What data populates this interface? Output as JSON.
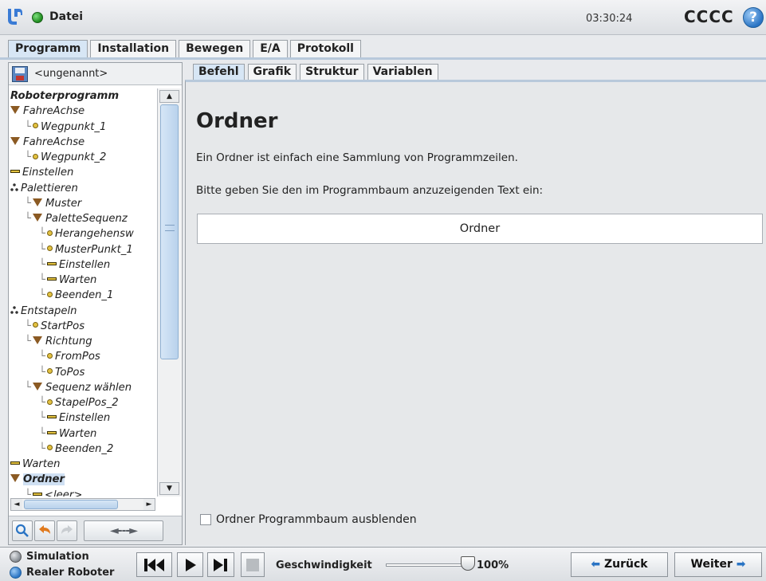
{
  "app": {
    "file_label": "Datei",
    "clock": "03:30:24",
    "robot_name": "CCCC",
    "help_glyph": "?"
  },
  "main_tabs": [
    "Programm",
    "Installation",
    "Bewegen",
    "E/A",
    "Protokoll"
  ],
  "program_name": "<ungenannt>",
  "tree": [
    {
      "indent": 0,
      "icon": "none",
      "label": "Roboterprogramm",
      "root": true
    },
    {
      "indent": 0,
      "icon": "folder-triangle",
      "label": "FahreAchse"
    },
    {
      "indent": 1,
      "icon": "waypoint-dot",
      "label": "Wegpunkt_1"
    },
    {
      "indent": 0,
      "icon": "folder-triangle",
      "label": "FahreAchse"
    },
    {
      "indent": 1,
      "icon": "waypoint-dot",
      "label": "Wegpunkt_2"
    },
    {
      "indent": 0,
      "icon": "bar",
      "label": "Einstellen"
    },
    {
      "indent": 0,
      "icon": "pallet",
      "label": "Palettieren"
    },
    {
      "indent": 1,
      "icon": "folder-triangle",
      "label": "Muster"
    },
    {
      "indent": 1,
      "icon": "folder-triangle",
      "label": "PaletteSequenz"
    },
    {
      "indent": 2,
      "icon": "waypoint-dot",
      "label": "Herangehensw"
    },
    {
      "indent": 2,
      "icon": "waypoint-dot",
      "label": "MusterPunkt_1"
    },
    {
      "indent": 2,
      "icon": "bar",
      "label": "Einstellen"
    },
    {
      "indent": 2,
      "icon": "bar",
      "label": "Warten"
    },
    {
      "indent": 2,
      "icon": "waypoint-dot",
      "label": "Beenden_1"
    },
    {
      "indent": 0,
      "icon": "pallet",
      "label": "Entstapeln"
    },
    {
      "indent": 1,
      "icon": "waypoint-dot",
      "label": "StartPos"
    },
    {
      "indent": 1,
      "icon": "folder-triangle",
      "label": "Richtung"
    },
    {
      "indent": 2,
      "icon": "waypoint-dot",
      "label": "FromPos"
    },
    {
      "indent": 2,
      "icon": "waypoint-dot",
      "label": "ToPos"
    },
    {
      "indent": 1,
      "icon": "folder-triangle",
      "label": "Sequenz wählen"
    },
    {
      "indent": 2,
      "icon": "waypoint-dot",
      "label": "StapelPos_2"
    },
    {
      "indent": 2,
      "icon": "bar",
      "label": "Einstellen"
    },
    {
      "indent": 2,
      "icon": "bar",
      "label": "Warten"
    },
    {
      "indent": 2,
      "icon": "waypoint-dot",
      "label": "Beenden_2"
    },
    {
      "indent": 0,
      "icon": "bar",
      "label": "Warten"
    },
    {
      "indent": 0,
      "icon": "folder-triangle",
      "label": "Ordner",
      "selected": true
    },
    {
      "indent": 1,
      "icon": "bar",
      "label": "<leer>"
    }
  ],
  "tree_toolbar": {
    "search_icon": "search-icon",
    "undo_icon": "undo-icon",
    "redo_icon": "redo-icon",
    "move_glyph": "◄---►"
  },
  "command_tabs": [
    "Befehl",
    "Grafik",
    "Struktur",
    "Variablen"
  ],
  "content": {
    "title": "Ordner",
    "description": "Ein Ordner ist einfach eine Sammlung von Programmzeilen.",
    "prompt": "Bitte geben Sie den im Programmbaum anzuzeigenden Text ein:",
    "folder_name_value": "Ordner",
    "hide_tree_label": "Ordner Programmbaum ausblenden",
    "hide_tree_checked": false
  },
  "bottom": {
    "mode_simulation": "Simulation",
    "mode_real": "Realer Roboter",
    "speed_label": "Geschwindigkeit",
    "speed_value": "100%",
    "speed_level": 1.0,
    "back_label": "Zurück",
    "next_label": "Weiter"
  },
  "colors": {
    "accent_blue": "#2a74c4",
    "status_green": "#1d8a1d",
    "node_icon_yellow": "#e3c241",
    "folder_brown": "#8b5a23"
  }
}
